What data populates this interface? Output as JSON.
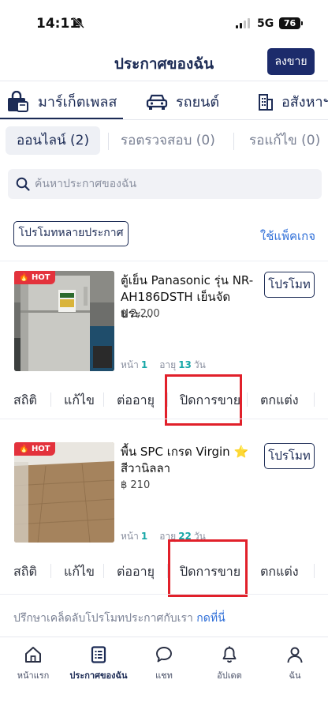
{
  "status_bar": {
    "time": "14:11",
    "network": "5G",
    "battery": "76"
  },
  "header": {
    "title": "ประกาศของฉัน",
    "post_button": "ลงขาย"
  },
  "categories": [
    {
      "label": "มาร์เก็ตเพลส",
      "icon": "bag-icon",
      "active": true
    },
    {
      "label": "รถยนต์",
      "icon": "car-icon"
    },
    {
      "label": "อสังหาฯ",
      "icon": "building-icon"
    }
  ],
  "status_tabs": [
    {
      "label": "ออนไลน์ (2)",
      "active": true
    },
    {
      "label": "รอตรวจสอบ (0)"
    },
    {
      "label": "รอแก้ไข (0)"
    }
  ],
  "search": {
    "placeholder": "ค้นหาประกาศของฉัน"
  },
  "promo_multi_button": "โปรโมทหลายประกาศ",
  "use_package_link": "ใช้แพ็คเกจ",
  "listings": [
    {
      "badge": "HOT",
      "title": "ตู้เย็น Panasonic รุ่น NR-AH186DSTH เย็นจัด ประ...",
      "price": "฿ 2,200",
      "promote_button": "โปรโมท",
      "page_label": "หน้า",
      "page_value": "1",
      "age_label": "อายุ",
      "age_value": "13",
      "age_unit": "วัน",
      "actions": [
        "สถิติ",
        "แก้ไข",
        "ต่ออายุ",
        "ปิดการขาย",
        "ตกแต่ง"
      ],
      "highlighted_action": "ปิดการขาย"
    },
    {
      "badge": "HOT",
      "title": "พื้น SPC เกรด Virgin ⭐ สีวานิลลา",
      "price": "฿ 210",
      "promote_button": "โปรโมท",
      "page_label": "หน้า",
      "page_value": "1",
      "age_label": "อายุ",
      "age_value": "22",
      "age_unit": "วัน",
      "actions": [
        "สถิติ",
        "แก้ไข",
        "ต่ออายุ",
        "ปิดการขาย",
        "ตกแต่ง"
      ],
      "highlighted_action": "ปิดการขาย"
    }
  ],
  "tip": {
    "text": "ปรึกษาเคล็ดลับโปรโมทประกาศกับเรา",
    "link": "กดที่นี่"
  },
  "bottom_nav": [
    {
      "label": "หน้าแรก",
      "icon": "home-icon"
    },
    {
      "label": "ประกาศของฉัน",
      "icon": "listing-icon",
      "active": true
    },
    {
      "label": "แชท",
      "icon": "chat-icon"
    },
    {
      "label": "อัปเดต",
      "icon": "bell-icon"
    },
    {
      "label": "ฉัน",
      "icon": "profile-icon"
    }
  ],
  "colors": {
    "primary": "#1c2b6b",
    "link": "#2f6fd8",
    "hot": "#e3323c",
    "highlight": "#e1202a",
    "teal": "#17a7a7"
  }
}
